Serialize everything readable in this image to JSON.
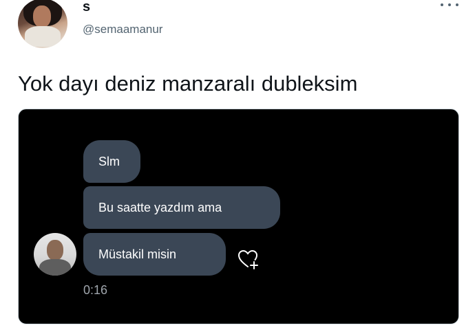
{
  "tweet": {
    "author_name": "s",
    "author_handle": "@semaamanur",
    "text": "Yok dayı deniz manzaralı dubleksim"
  },
  "media": {
    "messages": [
      {
        "text": "Slm"
      },
      {
        "text": "Bu saatte yazdım ama"
      },
      {
        "text": "Müstakil misin"
      }
    ],
    "timestamp": "0:16"
  },
  "colors": {
    "bubble": "#3b4756",
    "media_background": "#000000",
    "handle": "#536471"
  },
  "icons": [
    "more-icon",
    "heart-add-icon"
  ]
}
